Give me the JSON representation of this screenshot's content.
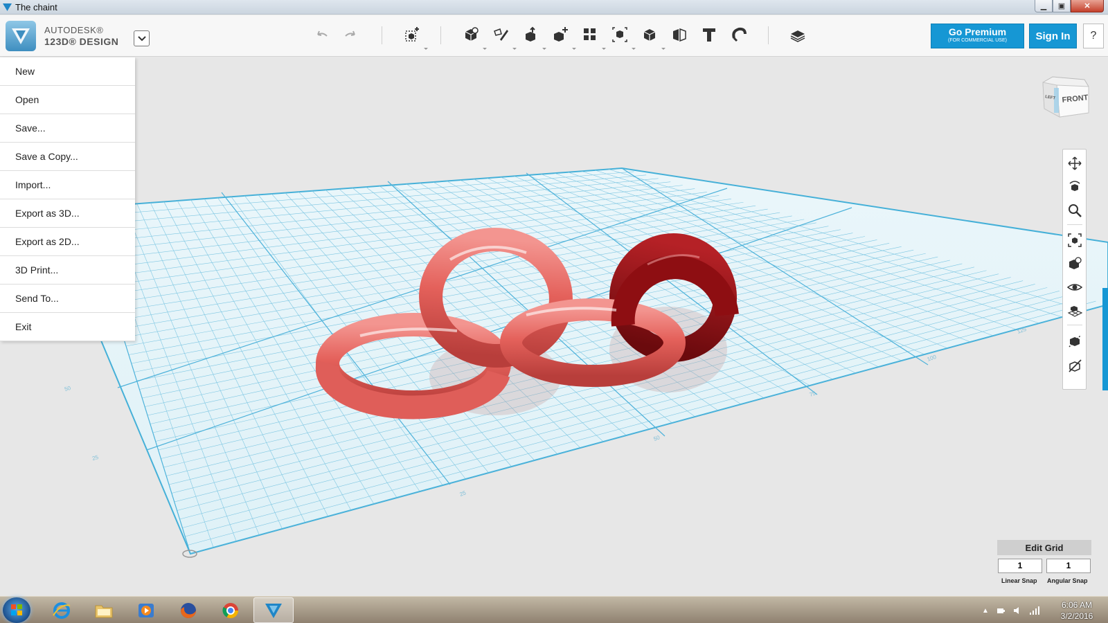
{
  "window": {
    "title": "The chaint"
  },
  "brand": {
    "line1": "AUTODESK®",
    "line2": "123D® DESIGN"
  },
  "header_buttons": {
    "premium_label": "Go Premium",
    "premium_sublabel": "(FOR COMMERCIAL USE)",
    "sign_in": "Sign In",
    "help": "?"
  },
  "toolbar_icons": [
    "undo-icon",
    "redo-icon",
    "transform-icon",
    "primitives-icon",
    "sketch-icon",
    "construct-icon",
    "modify-icon",
    "pattern-icon",
    "group-icon",
    "combine-icon",
    "measure-icon",
    "text-icon",
    "snap-icon",
    "materials-icon"
  ],
  "file_menu": {
    "items": [
      "New",
      "Open",
      "Save...",
      "Save a Copy...",
      "Import...",
      "Export as 3D...",
      "Export as 2D...",
      "3D Print...",
      "Send To...",
      "Exit"
    ]
  },
  "viewcube": {
    "left": "LEFT",
    "front": "FRONT"
  },
  "nav_icons": [
    "pan-icon",
    "orbit-icon",
    "zoom-icon",
    "fit-icon",
    "perspective-icon",
    "visibility-icon",
    "grid-icon",
    "solids-icon",
    "materials-toggle-icon"
  ],
  "grid_labels": [
    "25",
    "50",
    "75",
    "100",
    "125",
    "25",
    "50",
    "75",
    "100"
  ],
  "edit_grid": {
    "title": "Edit Grid",
    "linear_value": "1",
    "angular_value": "1",
    "linear_label": "Linear Snap",
    "angular_label": "Angular Snap"
  },
  "taskbar": {
    "apps": [
      "start-button",
      "internet-explorer-icon",
      "file-explorer-icon",
      "media-player-icon",
      "firefox-icon",
      "chrome-icon",
      "123d-design-icon"
    ],
    "clock_time": "6:06 AM",
    "clock_date": "3/2/2016"
  },
  "colors": {
    "accent": "#1697d4",
    "ring_light": "#e46a64",
    "ring_dark": "#8e0e12",
    "grid_line": "#54b7dc"
  }
}
